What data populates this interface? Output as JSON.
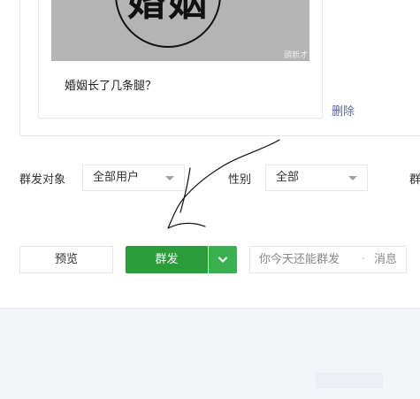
{
  "article": {
    "cover_text": "婚姻",
    "watermark": "頭新才",
    "title": "婚姻长了几条腿？",
    "delete_label": "删除"
  },
  "filters": {
    "target_label": "群发对象",
    "target_value": "全部用户",
    "gender_label": "性别",
    "gender_value": "全部",
    "region_label_partial": "群"
  },
  "actions": {
    "preview_label": "预览",
    "send_label": "群发",
    "tip_text_a": "你今天还能群发",
    "tip_text_b": "消息"
  },
  "colors": {
    "primary_green": "#2a9d3a",
    "dropdown_green": "#3cb050",
    "link_blue": "#576b95"
  }
}
